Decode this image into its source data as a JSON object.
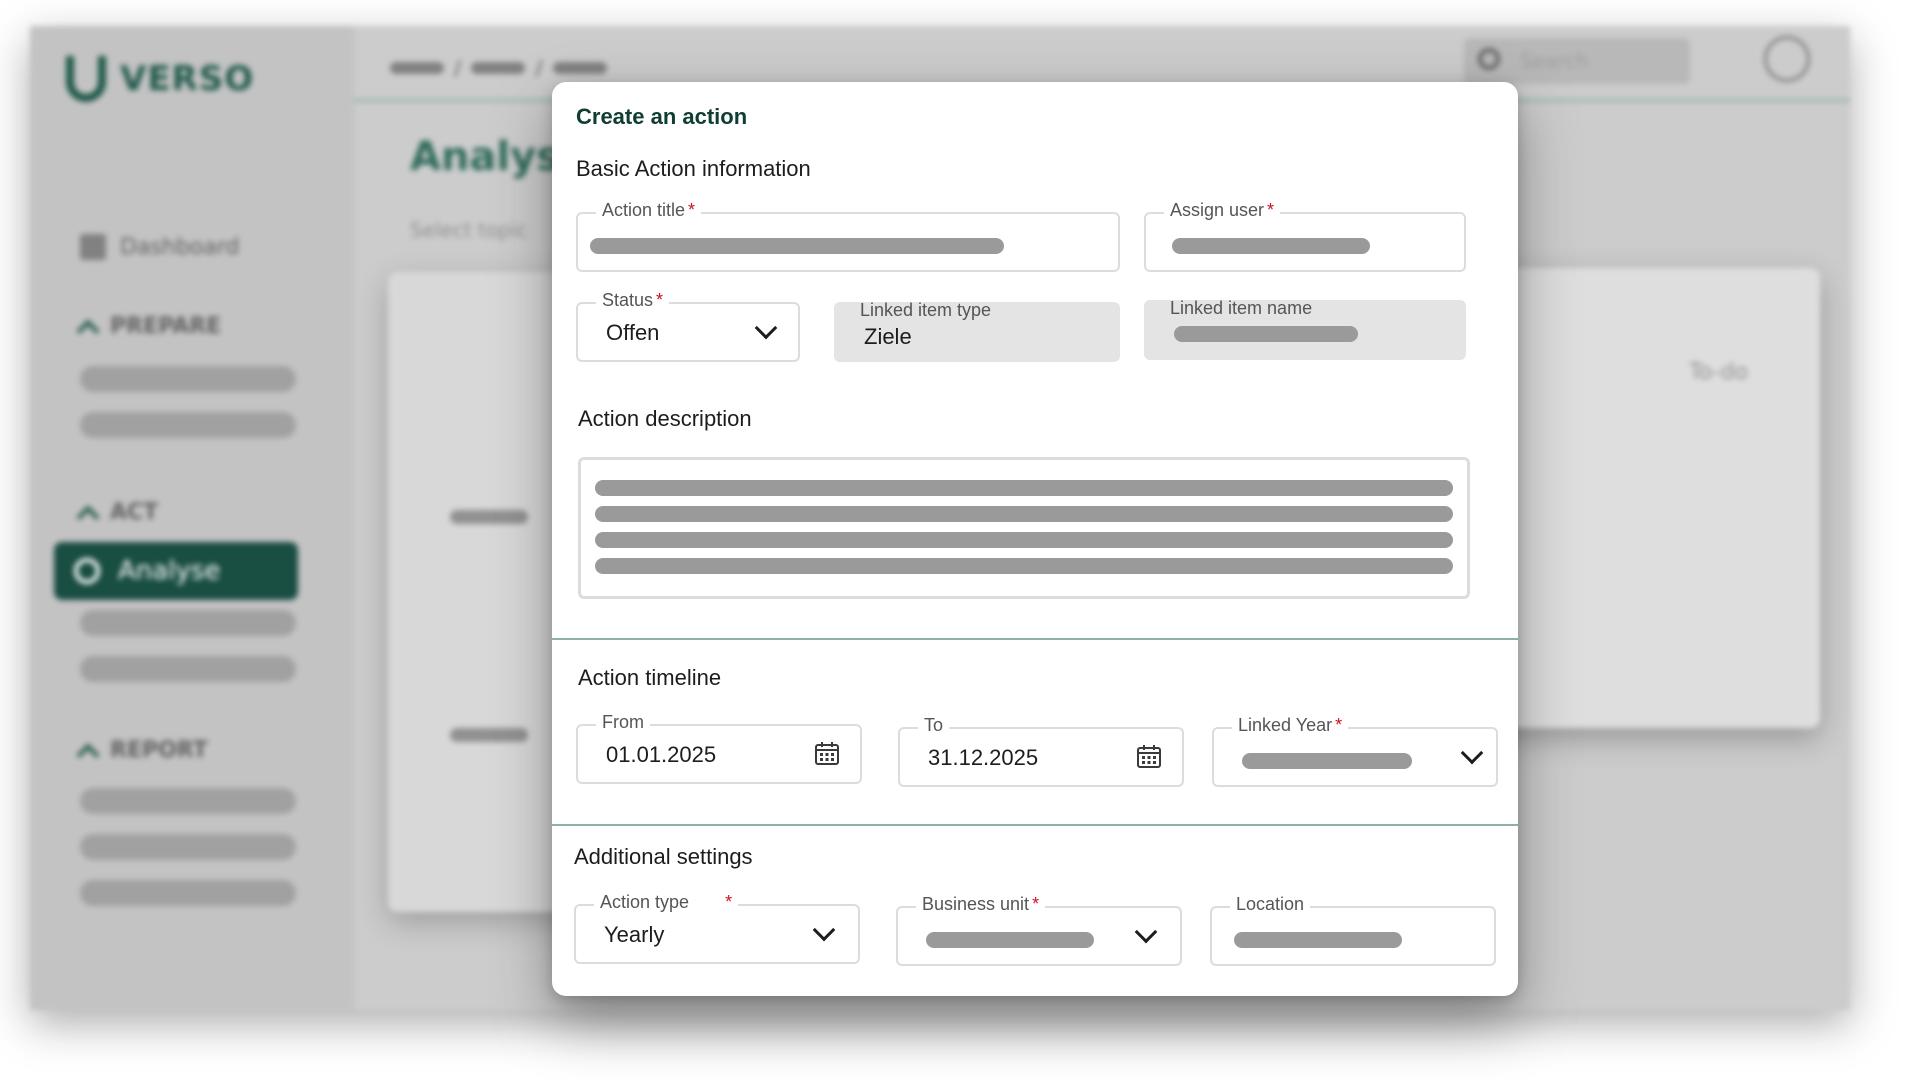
{
  "background": {
    "brand": "VERSO",
    "nav_dashboard": "Dashboard",
    "nav_prepare": "PREPARE",
    "nav_act": "ACT",
    "nav_analyse": "Analyse",
    "nav_report": "REPORT",
    "search_placeholder": "Search",
    "heading": "Analyse",
    "select_topic": "Select topic",
    "todo": "To-do"
  },
  "modal": {
    "title": "Create an action",
    "basic": {
      "heading": "Basic Action information",
      "action_title_label": "Action title",
      "assign_user_label": "Assign user",
      "status_label": "Status",
      "status_value": "Offen",
      "linked_item_type_label": "Linked item type",
      "linked_item_type_value": "Ziele",
      "linked_item_name_label": "Linked item name"
    },
    "description": {
      "heading": "Action description"
    },
    "timeline": {
      "heading": "Action timeline",
      "from_label": "From",
      "from_value": "01.01.2025",
      "to_label": "To",
      "to_value": "31.12.2025",
      "linked_year_label": "Linked Year"
    },
    "additional": {
      "heading": "Additional settings",
      "action_type_label": "Action type",
      "action_type_value": "Yearly",
      "business_unit_label": "Business unit",
      "location_label": "Location"
    },
    "required_mark": "*"
  },
  "colors": {
    "brand": "#063f33",
    "required": "#d0101d",
    "divider": "#8fb0a6"
  },
  "icons": {
    "dropdown": "chevron-down-icon",
    "date": "calendar-icon",
    "search": "search-icon"
  }
}
